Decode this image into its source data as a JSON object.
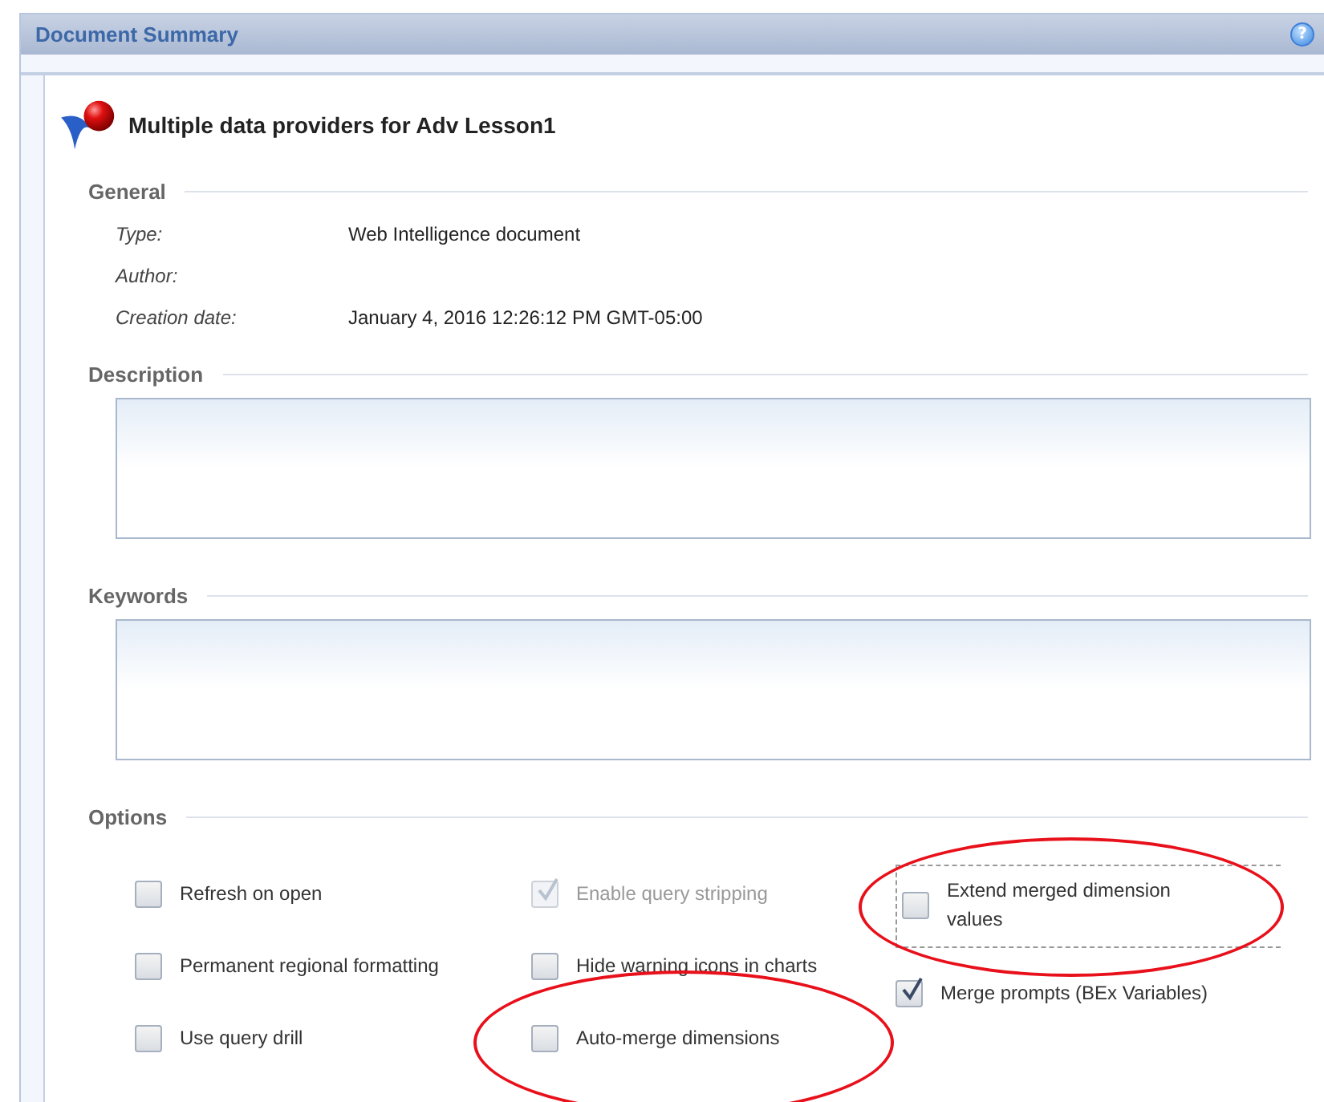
{
  "window": {
    "title": "Document Summary",
    "help": "?"
  },
  "document": {
    "title": "Multiple data providers for Adv Lesson1"
  },
  "general": {
    "heading": "General",
    "fields": [
      {
        "label": "Type:",
        "value": "Web Intelligence document"
      },
      {
        "label": "Author:"
      },
      {
        "label": "Creation date:",
        "value": "January 4, 2016 12:26:12 PM GMT-05:00"
      }
    ]
  },
  "description": {
    "heading": "Description"
  },
  "keywords": {
    "heading": "Keywords"
  },
  "options": {
    "heading": "Options",
    "columns": [
      [
        {
          "label": "Refresh on open",
          "checked": false,
          "disabled": false,
          "focused": false,
          "highlighted": false
        },
        {
          "label": "Permanent regional formatting",
          "checked": false,
          "disabled": false,
          "focused": false,
          "highlighted": false
        },
        {
          "label": "Use query drill",
          "checked": false,
          "disabled": false,
          "focused": false,
          "highlighted": false
        }
      ],
      [
        {
          "label": "Enable query stripping",
          "checked": true,
          "disabled": true,
          "focused": false,
          "highlighted": false
        },
        {
          "label": "Hide warning icons in charts",
          "checked": false,
          "disabled": false,
          "focused": false,
          "highlighted": false
        },
        {
          "label": "Auto-merge dimensions",
          "checked": false,
          "disabled": false,
          "focused": false,
          "highlighted": true
        }
      ],
      [
        {
          "label": "Extend merged dimension values",
          "checked": false,
          "disabled": false,
          "focused": true,
          "highlighted": true
        },
        {
          "label": "Merge prompts (BEx Variables)",
          "checked": true,
          "disabled": false,
          "focused": false,
          "highlighted": false
        }
      ]
    ]
  }
}
